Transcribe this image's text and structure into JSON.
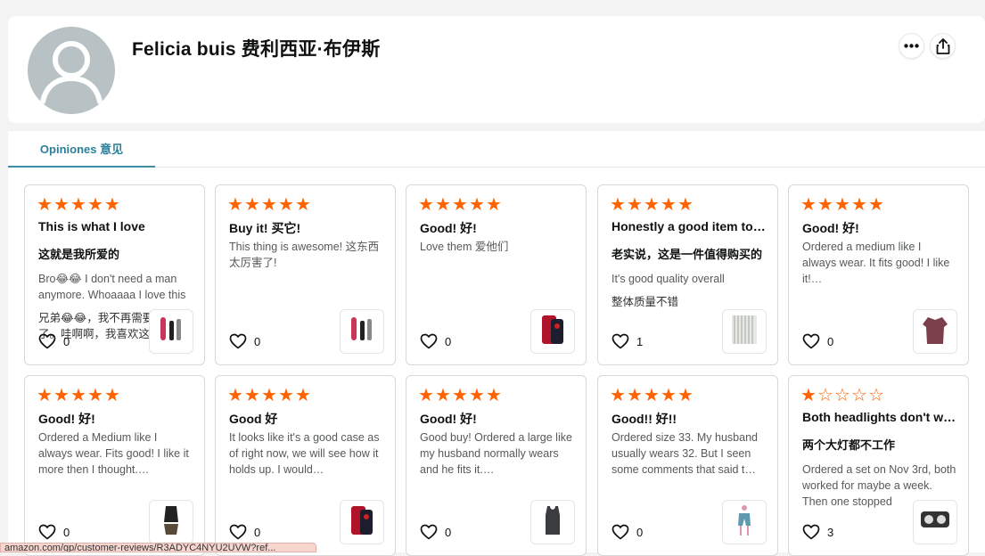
{
  "profile": {
    "name": "Felicia buis  费利西亚·布伊斯",
    "avatar_icon": "default-user-avatar-icon",
    "more_icon": "more-horizontal-icon",
    "share_icon": "share-icon"
  },
  "tabs": [
    {
      "label": "Opiniones  意见",
      "active": true
    }
  ],
  "colors": {
    "star": "#ff6200",
    "tab_active": "#2d7f98"
  },
  "reviews": [
    {
      "rating": 5,
      "title": "This is what I love",
      "title_cn": "这就是我所爱的",
      "body": "Bro😂😂 I don't need a man anymore. Whoaaaa I love this",
      "body_cn": "兄弟😂😂，我不再需要男人了。哇啊啊，我喜欢这个",
      "likes": "0",
      "thumb": "product-toy-image"
    },
    {
      "rating": 5,
      "title": "Buy it!  买它!",
      "title_cn": "",
      "body": "This thing is awesome!  这东西太厉害了!",
      "body_cn": "",
      "likes": "0",
      "thumb": "product-toy-image"
    },
    {
      "rating": 5,
      "title": "Good!  好!",
      "title_cn": "",
      "body": "Love them  爱他们",
      "body_cn": "",
      "likes": "0",
      "thumb": "phone-case-image"
    },
    {
      "rating": 5,
      "title": "Honestly a good item to have",
      "title_cn": "老实说，这是一件值得购买的",
      "body": "It's good quality overall",
      "body_cn": "整体质量不错",
      "likes": "1",
      "thumb": "curtain-image"
    },
    {
      "rating": 5,
      "title": "Good!  好!",
      "title_cn": "",
      "body": "Ordered a medium like I always wear. It fits good! I like it!…",
      "body_cn": "",
      "likes": "0",
      "thumb": "shirt-image"
    },
    {
      "rating": 5,
      "title": "Good!  好!",
      "title_cn": "",
      "body": "Ordered a Medium like I always wear. Fits good! I like it more then I thought.…",
      "body_cn": "",
      "likes": "0",
      "thumb": "swimsuit-image"
    },
    {
      "rating": 5,
      "title": "Good  好",
      "title_cn": "",
      "body": "It looks like it's a good case as of right now, we will see how it holds up. I would…",
      "body_cn": "",
      "likes": "0",
      "thumb": "phone-case-image"
    },
    {
      "rating": 5,
      "title": "Good!  好!",
      "title_cn": "",
      "body": "Good buy! Ordered a large like my husband normally wears and he fits it.…",
      "body_cn": "",
      "likes": "0",
      "thumb": "tank-top-image"
    },
    {
      "rating": 5,
      "title": "Good!!  好!!",
      "title_cn": "",
      "body": "Ordered size 33. My husband usually wears 32. But I seen some comments that said t…",
      "body_cn": "",
      "likes": "0",
      "thumb": "shorts-image"
    },
    {
      "rating": 1,
      "title": "Both headlights don't work",
      "title_cn": "两个大灯都不工作",
      "body": "Ordered a set on Nov 3rd, both worked for maybe a week. Then one stopped",
      "body_cn": "",
      "likes": "3",
      "thumb": "headlight-image"
    }
  ],
  "status_url": "amazon.com/gp/customer-reviews/R3ADYC4NYU2UVW?ref..."
}
